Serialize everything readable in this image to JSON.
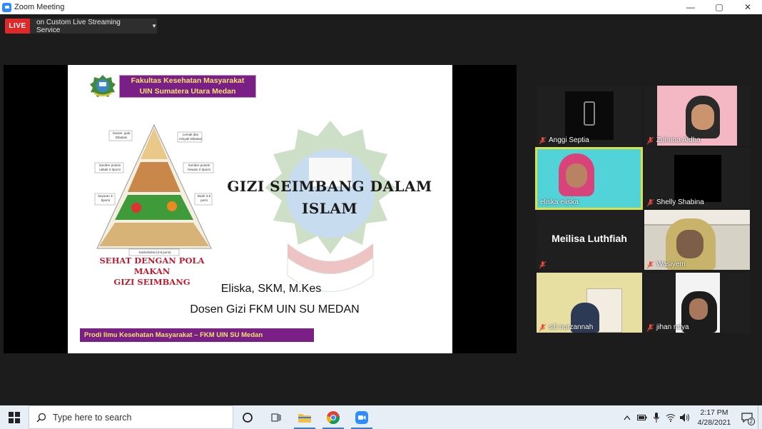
{
  "window": {
    "title": "Zoom Meeting",
    "minimize": "—",
    "maximize": "▢",
    "close": "✕"
  },
  "live": {
    "badge": "LIVE",
    "service": "on Custom Live Streaming Service"
  },
  "slide": {
    "faculty_line1": "Fakultas Kesehatan Masyarakat",
    "faculty_line2": "UIN Sumatera Utara Medan",
    "pyramid_labels": {
      "top_left": "Garam, gula Dibatasi",
      "top_right": "Lemak dan minyak Dibatasi",
      "mid_left": "Sumber protein nabati 2-3porsi",
      "mid_right": "Sumber protein hewani 2-3porsi",
      "low_left": "Sayuran 3-5porsi",
      "low_right": "Buah 3-5 porsi",
      "base": "Karbohidrat (3-8 porsi)"
    },
    "slogan_line1": "SEHAT DENGAN POLA MAKAN",
    "slogan_line2": "GIZI SEIMBANG",
    "title_line1": "GIZI SEIMBANG DALAM",
    "title_line2": "ISLAM",
    "author": "Eliska, SKM, M.Kes",
    "position": "Dosen Gizi FKM UIN SU MEDAN",
    "footer": "Prodi Ilmu Kesehatan Masyarakat – FKM UIN SU Medan"
  },
  "participants": [
    {
      "name": "Anggi Septia",
      "muted": true,
      "video": "dark"
    },
    {
      "name": "Zuhrina Aidha",
      "muted": true,
      "video": "pink"
    },
    {
      "name": "eliska eliska",
      "muted": false,
      "video": "teal",
      "speaking": true
    },
    {
      "name": "Shelly Shabina",
      "muted": true,
      "video": "black"
    },
    {
      "name": "Meilisa Luthfiah",
      "muted": true,
      "video": "none"
    },
    {
      "name": "Wasiyem",
      "muted": true,
      "video": "room"
    },
    {
      "name": "siti nurzannah",
      "muted": true,
      "video": "wall"
    },
    {
      "name": "jihan ralya",
      "muted": true,
      "video": "white"
    }
  ],
  "taskbar": {
    "search_placeholder": "Type here to search",
    "time": "2:17 PM",
    "date": "4/28/2021",
    "notification_count": "2"
  },
  "colors": {
    "accent_live": "#e02828",
    "speaker_border": "#d9e04a",
    "purple_box": "#7a1f86",
    "gold_text": "#f3e36d"
  }
}
